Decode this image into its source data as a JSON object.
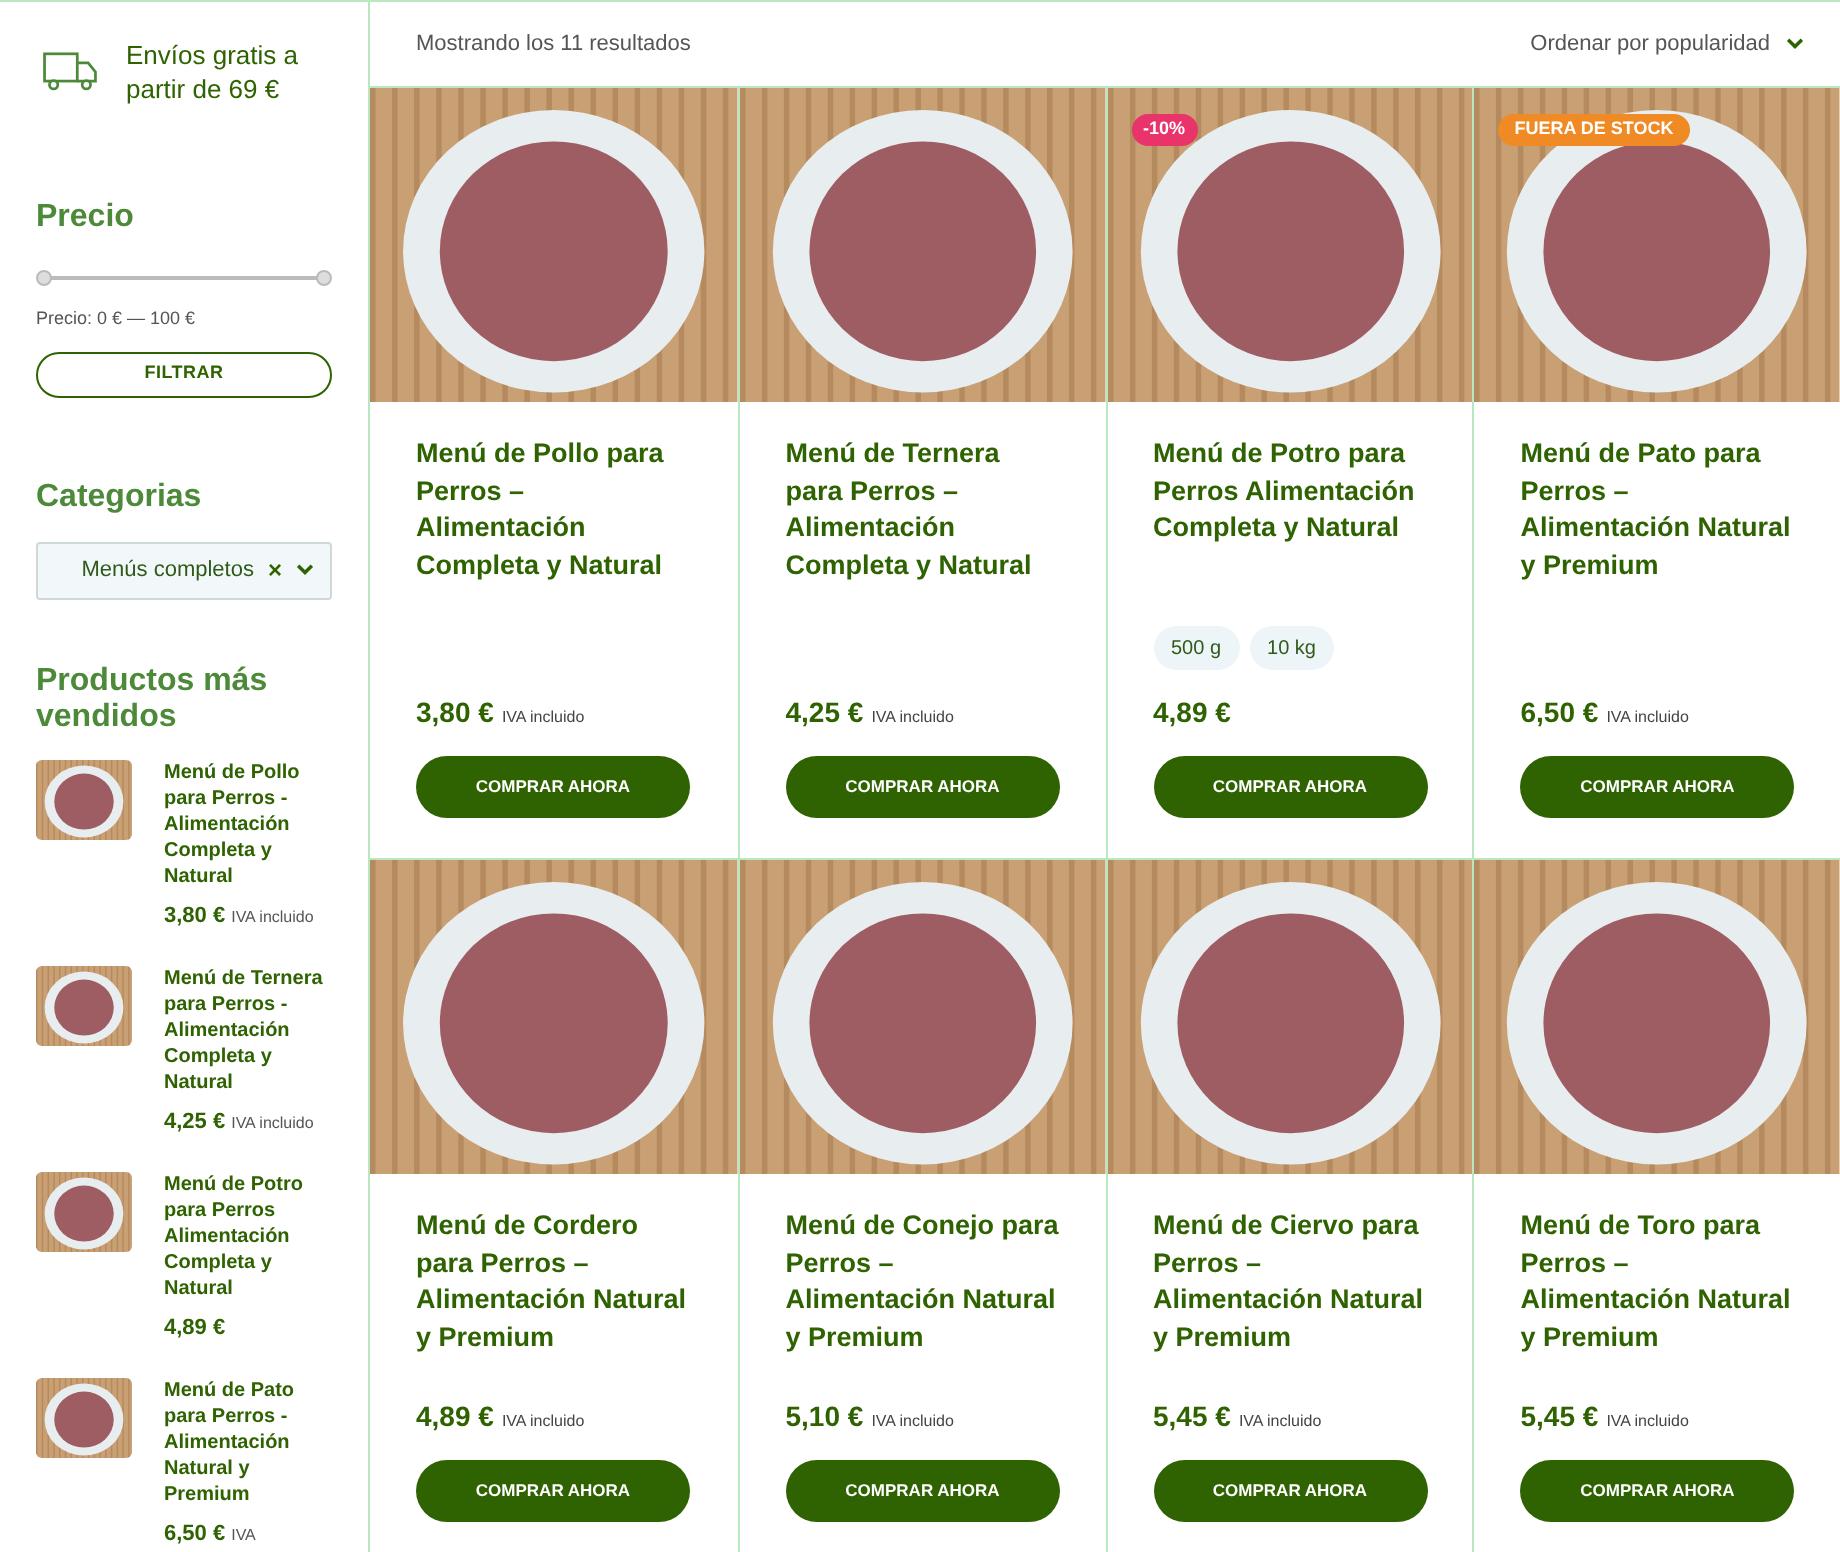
{
  "sidebar": {
    "shipping": {
      "text": "Envíos gratis a partir de 69 €"
    },
    "price_filter": {
      "title": "Precio",
      "range_min": {
        "level": 0
      },
      "range_max": {
        "level": 1
      },
      "reading": "Precio: 0 € — 100 €",
      "button": "FILTRAR"
    },
    "categories": {
      "title": "Categorias",
      "selected_value": "Menús completos",
      "clear": "×"
    },
    "best_sellers": {
      "title": "Productos más vendidos",
      "items": [
        {
          "name": "Menú de Pollo para Perros - Alimentación Completa y Natural",
          "price": "3,80 €",
          "tax_note": "IVA incluido"
        },
        {
          "name": "Menú de Ternera para Perros - Alimentación Completa y Natural",
          "price": "4,25 €",
          "tax_note": "IVA incluido"
        },
        {
          "name": "Menú de Potro para Perros Alimentación Completa y Natural",
          "price": "4,89 €"
        },
        {
          "name": "Menú de Pato para Perros - Alimentación Natural y Premium",
          "price": "6,50 €",
          "tax_note": "IVA"
        }
      ]
    }
  },
  "toolbar": {
    "result_count": "Mostrando los 11 resultados",
    "sort": "Ordenar por popularidad"
  },
  "products": [
    {
      "name": "Menú de Pollo para Perros – Alimentación Completa y Natural",
      "price": "3,80 €",
      "tax_note": "IVA incluido",
      "button": "COMPRAR AHORA"
    },
    {
      "name": "Menú de Ternera para Perros – Alimentación Completa y Natural",
      "price": "4,25 €",
      "tax_note": "IVA incluido",
      "button": "COMPRAR AHORA"
    },
    {
      "name": "Menú de Potro para Perros Alimentación Completa y Natural",
      "badge": {
        "kind": "sale",
        "text": "-10%"
      },
      "variations": [
        "500 g",
        "10 kg"
      ],
      "price": "4,89 €",
      "button": "COMPRAR AHORA"
    },
    {
      "name": "Menú de Pato para Perros – Alimentación Natural y Premium",
      "badge": {
        "kind": "out_of_stock",
        "text": "FUERA DE STOCK"
      },
      "price": "6,50 €",
      "tax_note": "IVA incluido",
      "button": "COMPRAR AHORA"
    },
    {
      "name": "Menú de Cordero para Perros – Alimentación Natural y Premium",
      "price": "4,89 €",
      "tax_note": "IVA incluido",
      "button": "COMPRAR AHORA"
    },
    {
      "name": "Menú de Conejo para Perros – Alimentación Natural y Premium",
      "price": "5,10 €",
      "tax_note": "IVA incluido",
      "button": "COMPRAR AHORA"
    },
    {
      "name": "Menú de Ciervo para Perros – Alimentación Natural y Premium",
      "price": "5,45 €",
      "tax_note": "IVA incluido",
      "button": "COMPRAR AHORA"
    },
    {
      "name": "Menú de Toro para Perros – Alimentación Natural y Premium",
      "price": "5,45 €",
      "tax_note": "IVA incluido",
      "button": "COMPRAR AHORA"
    }
  ]
}
